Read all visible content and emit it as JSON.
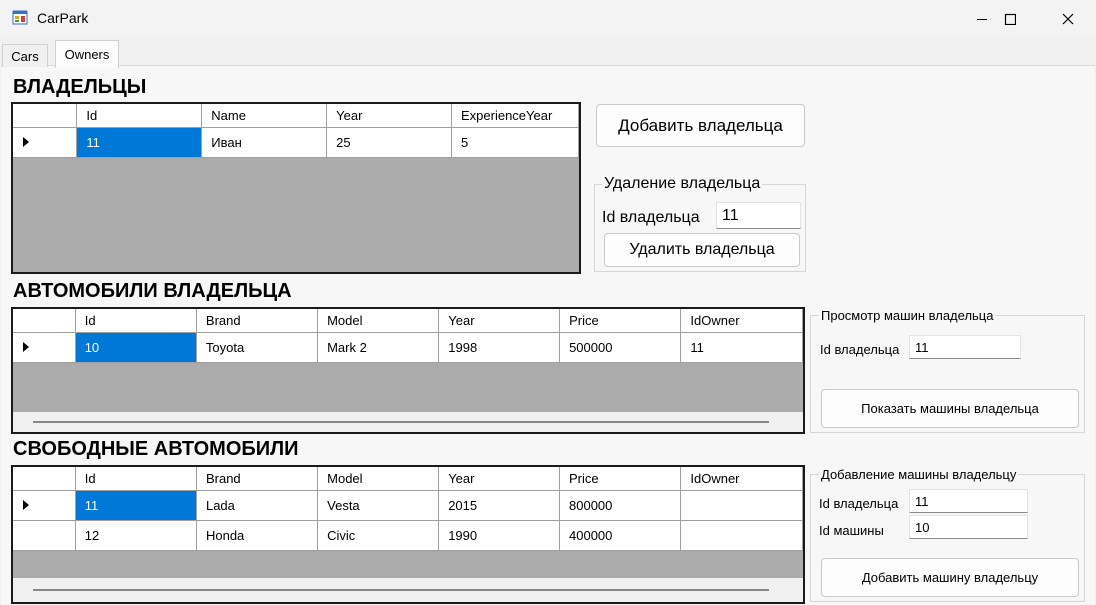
{
  "window": {
    "title": "CarPark",
    "icons": {
      "app": "form-icon",
      "minimize": "minimize-icon",
      "maximize": "maximize-icon",
      "close": "close-icon"
    }
  },
  "tabs": [
    {
      "label": "Cars"
    },
    {
      "label": "Owners",
      "active": true
    }
  ],
  "owners": {
    "heading": "ВЛАДЕЛЬЦЫ",
    "columns": [
      "Id",
      "Name",
      "Year",
      "ExperienceYear"
    ],
    "rows": [
      [
        "11",
        "Иван",
        "25",
        "5"
      ]
    ]
  },
  "add_owner_button": "Добавить владельца",
  "delete_group": {
    "title": "Удаление владельца",
    "id_label": "Id владельца",
    "id_value": "11",
    "button": "Удалить владельца"
  },
  "owner_cars": {
    "heading": "АВТОМОБИЛИ ВЛАДЕЛЬЦА",
    "columns": [
      "Id",
      "Brand",
      "Model",
      "Year",
      "Price",
      "IdOwner"
    ],
    "rows": [
      [
        "10",
        "Toyota",
        "Mark 2",
        "1998",
        "500000",
        "11"
      ]
    ]
  },
  "view_group": {
    "title": "Просмотр машин владельца",
    "id_label": "Id владельца",
    "id_value": "11",
    "button": "Показать машины владельца"
  },
  "free_cars": {
    "heading": "СВОБОДНЫЕ АВТОМОБИЛИ",
    "columns": [
      "Id",
      "Brand",
      "Model",
      "Year",
      "Price",
      "IdOwner"
    ],
    "rows": [
      [
        "11",
        "Lada",
        "Vesta",
        "2015",
        "800000",
        ""
      ],
      [
        "12",
        "Honda",
        "Civic",
        "1990",
        "400000",
        ""
      ]
    ]
  },
  "assign_group": {
    "title": "Добавление машины владельцу",
    "owner_label": "Id владельца",
    "owner_value": "11",
    "car_label": "Id машины",
    "car_value": "10",
    "button": "Добавить машину владельцу"
  },
  "colors": {
    "selection": "#0078d7",
    "grid_empty": "#ababab"
  }
}
